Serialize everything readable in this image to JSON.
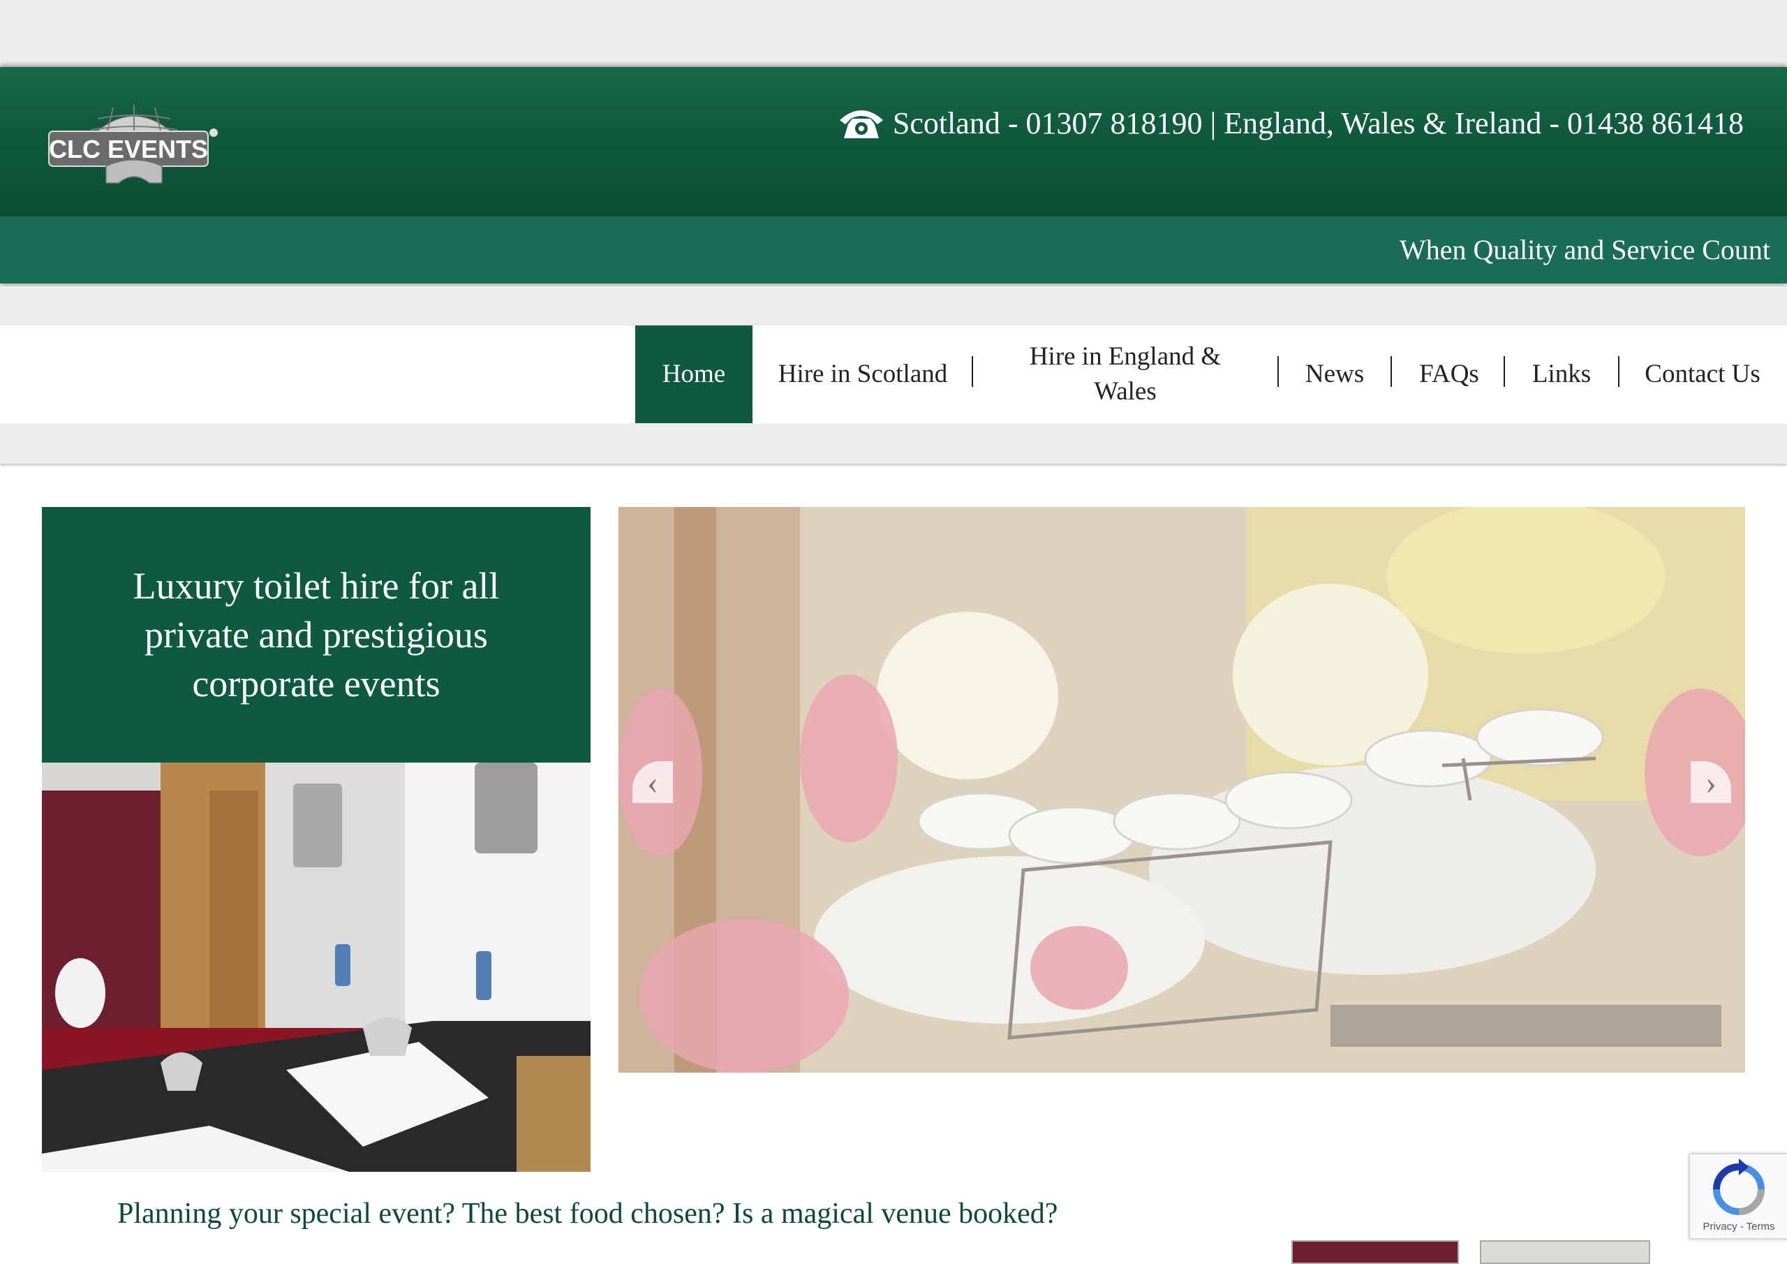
{
  "brand": {
    "logo_text": "CLC EVENTS",
    "logo_mark": "®"
  },
  "header": {
    "phone_line": "Scotland - 01307 818190 | England, Wales & Ireland - 01438 861418",
    "tagline": "When Quality and Service Count"
  },
  "nav": {
    "items": [
      {
        "label": "Home",
        "active": true
      },
      {
        "label": "Hire in Scotland",
        "active": false
      },
      {
        "label": "Hire in England & Wales",
        "active": false
      },
      {
        "label": "News",
        "active": false
      },
      {
        "label": "FAQs",
        "active": false
      },
      {
        "label": "Links",
        "active": false
      },
      {
        "label": "Contact Us",
        "active": false
      }
    ]
  },
  "hero": {
    "heading": "Luxury toilet hire for all private and prestigious corporate events"
  },
  "slider": {
    "prev_icon": "chevron-left-icon",
    "next_icon": "chevron-right-icon"
  },
  "intro": {
    "text": "Planning your special event? The best food chosen? Is a magical venue booked?"
  },
  "recaptcha": {
    "footer": "Privacy - Terms"
  },
  "colors": {
    "primary_green": "#0e5a3e",
    "tag_green": "#1b6c54",
    "text_green": "#0d4a32"
  }
}
